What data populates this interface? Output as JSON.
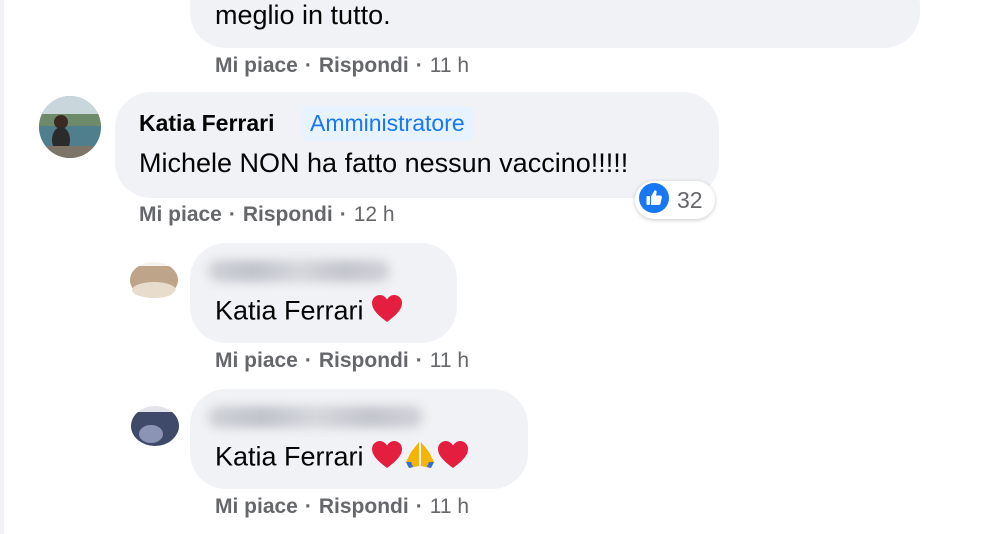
{
  "comments": [
    {
      "text": "meglio in tutto.",
      "like_label": "Mi piace",
      "reply_label": "Rispondi",
      "time": "11 h"
    },
    {
      "author": "Katia Ferrari",
      "role_badge": "Amministratore",
      "text": "Michele NON ha fatto nessun vaccino!!!!!",
      "like_label": "Mi piace",
      "reply_label": "Rispondi",
      "time": "12 h",
      "reaction": {
        "icon": "like-reaction-icon",
        "count": "32"
      }
    },
    {
      "author_redacted": true,
      "text": "Katia Ferrari",
      "emoji": [
        "red-heart-icon"
      ],
      "like_label": "Mi piace",
      "reply_label": "Rispondi",
      "time": "11 h"
    },
    {
      "author_redacted": true,
      "text": "Katia Ferrari",
      "emoji": [
        "red-heart-icon",
        "folded-hands-icon",
        "red-heart-icon"
      ],
      "like_label": "Mi piace",
      "reply_label": "Rispondi",
      "time": "11 h"
    }
  ],
  "colors": {
    "bubble": "#f0f2f5",
    "meta_text": "#65676b",
    "admin_badge_bg": "#e7f3ff",
    "admin_badge_text": "#1877f2",
    "heart": "#e41e3f"
  }
}
